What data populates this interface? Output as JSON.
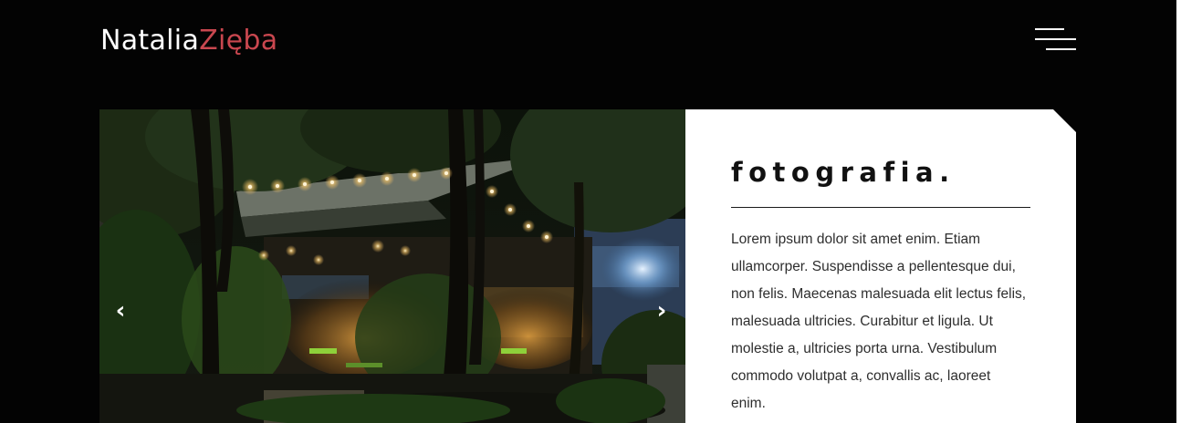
{
  "header": {
    "logo_first": "Natalia",
    "logo_second": "Zięba",
    "logo_colors": {
      "first": "#ffffff",
      "second": "#c9474f"
    },
    "menu_icon": "hamburger-icon"
  },
  "slider": {
    "image_description_icon": "photo",
    "prev_label": "‹",
    "next_label": "›"
  },
  "card": {
    "title": "fotografia.",
    "body": "Lorem ipsum dolor sit amet enim. Etiam ullamcorper. Suspendisse a pellentesque dui, non felis. Maecenas malesuada elit lectus felis, malesuada ultricies. Curabitur et ligula. Ut molestie a, ultricies porta urna. Vestibulum commodo volutpat a, convallis ac, laoreet enim."
  },
  "colors": {
    "background": "#030303",
    "card": "#ffffff",
    "accent": "#c9474f"
  }
}
